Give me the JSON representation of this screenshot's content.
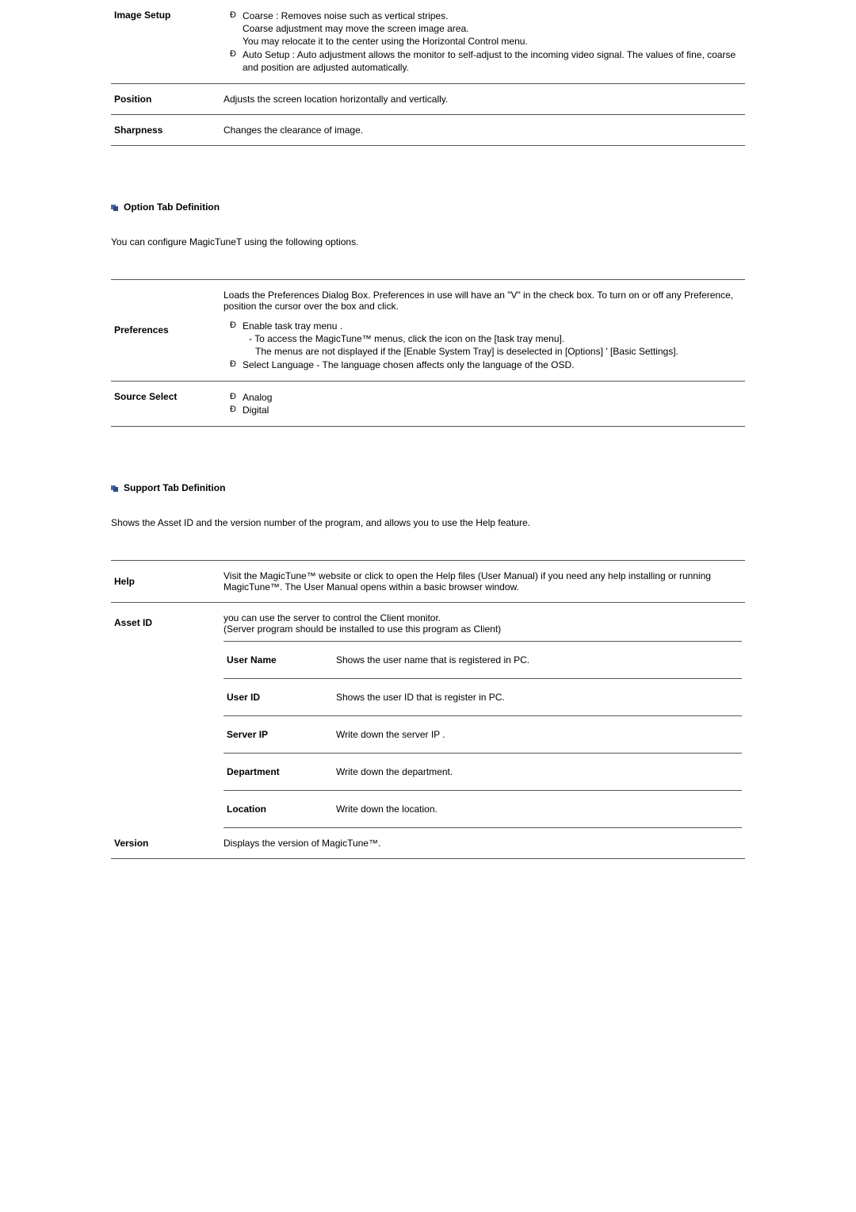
{
  "top_table": {
    "rows": [
      {
        "label": "Image Setup",
        "items": [
          {
            "text": "Coarse : Removes noise such as vertical stripes.",
            "marker": true
          },
          {
            "text": "Coarse adjustment may move the screen image area.",
            "marker": false
          },
          {
            "text": "You may relocate it to the center using the Horizontal Control menu.",
            "marker": false
          },
          {
            "text": "Auto Setup : Auto adjustment allows the monitor to self-adjust to the incoming video signal. The values of fine, coarse and position are adjusted automatically.",
            "marker": true
          }
        ]
      },
      {
        "label": "Position",
        "plain": "Adjusts the screen location horizontally and vertically."
      },
      {
        "label": "Sharpness",
        "plain": "Changes the clearance of image."
      }
    ]
  },
  "option_section": {
    "heading": "Option Tab Definition",
    "intro": "You can configure MagicTuneT using the following options.",
    "pref_intro": "Loads the Preferences Dialog Box. Preferences in use will have an \"V\" in the check box. To turn on or off any Preference, position the cursor over the box and click.",
    "pref_label": "Preferences",
    "pref_item1": "Enable task tray menu .",
    "pref_item1_sub1": "- To access the MagicTune™ menus, click the icon on the [task tray menu].",
    "pref_item1_sub2": "The menus are not displayed if the [Enable System Tray] is deselected in [Options] ' [Basic Settings].",
    "pref_item2": "Select Language - The language chosen affects only the language of the OSD.",
    "source_label": "Source Select",
    "source_opt1": "Analog",
    "source_opt2": "Digital"
  },
  "support_section": {
    "heading": "Support Tab Definition",
    "intro": "Shows the Asset ID and the version number of the program, and allows you to use the Help feature.",
    "help_label": "Help",
    "help_text": "Visit the MagicTune™ website or click to open the Help files (User Manual) if you need any help installing or running MagicTune™. The User Manual opens within a basic browser window.",
    "asset_label": "Asset ID",
    "asset_text1": "you can use the server to control the Client monitor.",
    "asset_text2": "(Server program should be installed to use this program as Client)",
    "sub_rows": [
      {
        "label": "User Name",
        "text": "Shows the user name that is registered in PC."
      },
      {
        "label": "User ID",
        "text": "Shows the user ID that is register in PC."
      },
      {
        "label": "Server IP",
        "text": "Write down the server IP ."
      },
      {
        "label": "Department",
        "text": "Write down the department."
      },
      {
        "label": "Location",
        "text": "Write down the location."
      }
    ],
    "version_label": "Version",
    "version_text": "Displays the version of MagicTune™."
  }
}
